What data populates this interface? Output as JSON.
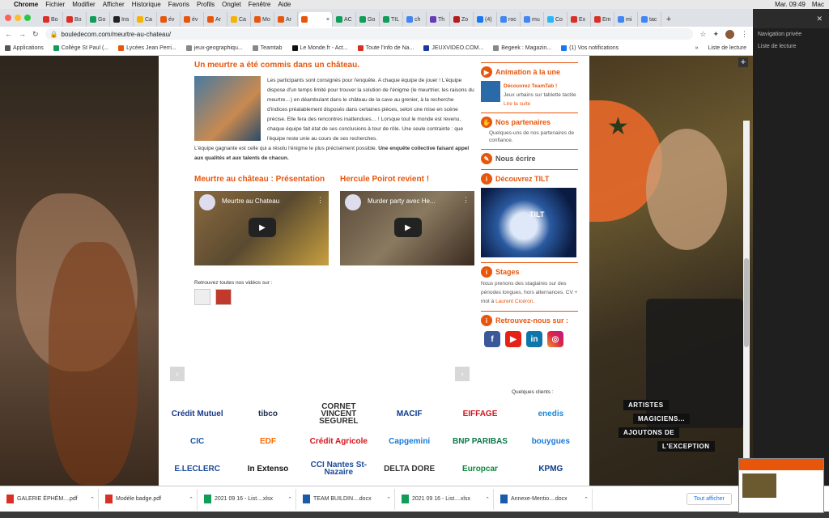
{
  "menubar": {
    "items": [
      "Chrome",
      "Fichier",
      "Modifier",
      "Afficher",
      "Historique",
      "Favoris",
      "Profils",
      "Onglet",
      "Fenêtre",
      "Aide"
    ],
    "clock": "Mar. 09:49",
    "user": "Mac"
  },
  "tabs": [
    {
      "label": "Bo",
      "color": "#d93025"
    },
    {
      "label": "Bo",
      "color": "#d93025"
    },
    {
      "label": "Go",
      "color": "#0f9d58"
    },
    {
      "label": "Ins",
      "color": "#222"
    },
    {
      "label": "Ca",
      "color": "#f4b400"
    },
    {
      "label": "év",
      "color": "#e8560c"
    },
    {
      "label": "év",
      "color": "#e8560c"
    },
    {
      "label": "Ar",
      "color": "#e8560c"
    },
    {
      "label": "Ca",
      "color": "#f4b400"
    },
    {
      "label": "Mo",
      "color": "#e8560c"
    },
    {
      "label": "Ar",
      "color": "#e8560c"
    },
    {
      "label": "",
      "color": "#e8560c"
    },
    {
      "label": "AC",
      "color": "#0f9d58"
    },
    {
      "label": "Go",
      "color": "#0f9d58"
    },
    {
      "label": "TIL",
      "color": "#0f9d58"
    },
    {
      "label": "ch",
      "color": "#4285f4"
    },
    {
      "label": "Th",
      "color": "#673ab7"
    },
    {
      "label": "Zo",
      "color": "#b71c1c"
    },
    {
      "label": "(4)",
      "color": "#1877f2"
    },
    {
      "label": "roc",
      "color": "#4285f4"
    },
    {
      "label": "mu",
      "color": "#4285f4"
    },
    {
      "label": "Co",
      "color": "#29b6f6"
    },
    {
      "label": "Ex",
      "color": "#d93025"
    },
    {
      "label": "Em",
      "color": "#d93025"
    },
    {
      "label": "mi",
      "color": "#4285f4"
    },
    {
      "label": "tac",
      "color": "#4285f4"
    }
  ],
  "toolbar": {
    "url": "bouledecom.com/meurtre-au-chateau/",
    "private": "Navigation privée"
  },
  "bookmarks": [
    {
      "label": "Applications",
      "color": "#555"
    },
    {
      "label": "Collège St Paul (...",
      "color": "#0f9d58"
    },
    {
      "label": "Lycées Jean Perri...",
      "color": "#e8560c"
    },
    {
      "label": "jeux-geographiqu...",
      "color": "#888"
    },
    {
      "label": "Teamtab",
      "color": "#888"
    },
    {
      "label": "Le Monde.fr - Act...",
      "color": "#111"
    },
    {
      "label": "Toute l'info de Na...",
      "color": "#d93025"
    },
    {
      "label": "JEUXVIDEO.COM...",
      "color": "#1a3aa0"
    },
    {
      "label": "Begeek : Magazin...",
      "color": "#888"
    },
    {
      "label": "(1) Vos notifications",
      "color": "#1877f2"
    }
  ],
  "reading_list": "Liste de lecture",
  "main": {
    "heading": "Un meurtre a été commis dans un château.",
    "p1": "Les participants sont consignés pour l'enquête. A chaque équipe de jouer ! L'équipe dispose d'un temps limité pour trouver la solution de l'énigme (le meurtrier, les raisons du meurtre…) en déambulant dans le château de la cave au grenier, à la recherche d'indices préalablement disposés dans certaines pièces, selon une mise en scène précise. Elle fera des rencontres inattendues… ! Lorsque tout le monde est revenu, chaque équipe fait état de ses conclusions à tour de rôle. Une seule contrainte : que l'équipe reste unie au cours de ses recherches.",
    "p2_normal": "L'équipe gagnante est celle qui a résolu l'énigme le plus précisément possible. ",
    "p2_bold": "Une enquête collective faisant appel aux qualités et aux talents de chacun.",
    "video1_heading": "Meurtre au château : Présentation",
    "video1_title": "Meurtre au Chateau",
    "video2_heading": "Hercule Poirot revient !",
    "video2_title": "Murder party avec He...",
    "all_videos": "Retrouvez toutes nos vidéos sur :"
  },
  "sidebar": {
    "anim_title": "Animation à la une",
    "teamtab_title": "Découvrez TeamTab !",
    "teamtab_text": "Jeux urbains sur tablette tactile",
    "teamtab_link": "Lire la suite",
    "partners_title": "Nos partenaires",
    "partners_text": "Quelques-uns de nos partenaires de confiance.",
    "write_title": "Nous écrire",
    "tilt_title": "Découvrez TILT",
    "tilt_logo": "TILT",
    "stages_title": "Stages",
    "stages_text": "Nous prenons des stagiaires sur des périodes longues, hors alternances. CV + mot à ",
    "stages_link": "Laurent Cicéron",
    "find_title": "Retrouvez-nous sur :"
  },
  "clients": {
    "title": "Quelques clients :",
    "logos": [
      {
        "name": "Crédit Mutuel",
        "color": "#1a3a8a"
      },
      {
        "name": "tibco",
        "color": "#1a2a4a"
      },
      {
        "name": "CORNET VINCENT SEGUREL",
        "color": "#333"
      },
      {
        "name": "MACIF",
        "color": "#0a3a8a"
      },
      {
        "name": "EIFFAGE",
        "color": "#d3131b"
      },
      {
        "name": "enedis",
        "color": "#1a8ad8"
      },
      {
        "name": "CIC",
        "color": "#1a5aa8"
      },
      {
        "name": "EDF",
        "color": "#ff6a00"
      },
      {
        "name": "Crédit Agricole",
        "color": "#d3131b"
      },
      {
        "name": "Capgemini",
        "color": "#1a7ad8"
      },
      {
        "name": "BNP PARIBAS",
        "color": "#0a7a4a"
      },
      {
        "name": "bouygues",
        "color": "#1a7ad8"
      },
      {
        "name": "E.LECLERC",
        "color": "#1a4a9a"
      },
      {
        "name": "In Extenso",
        "color": "#111"
      },
      {
        "name": "CCI Nantes St-Nazaire",
        "color": "#1a4a9a"
      },
      {
        "name": "DELTA DORE",
        "color": "#333"
      },
      {
        "name": "Europcar",
        "color": "#0a8a3a"
      },
      {
        "name": "KPMG",
        "color": "#0a3a8a"
      }
    ]
  },
  "banner": [
    "ARTISTES",
    "MAGICIENS...",
    "AJOUTONS DE",
    "L'EXCEPTION"
  ],
  "downloads": [
    {
      "name": "GALERIE ÉPHÉM....pdf",
      "color": "#d93025"
    },
    {
      "name": "Modèle badge.pdf",
      "color": "#d93025"
    },
    {
      "name": "2021 09 16 - List....xlsx",
      "color": "#0f9d58"
    },
    {
      "name": "TEAM BUILDIN....docx",
      "color": "#1a5aa8"
    },
    {
      "name": "2021 09 16 - List....xlsx",
      "color": "#0f9d58"
    },
    {
      "name": "Annexe-Mentio....docx",
      "color": "#1a5aa8"
    }
  ],
  "show_all": "Tout afficher"
}
